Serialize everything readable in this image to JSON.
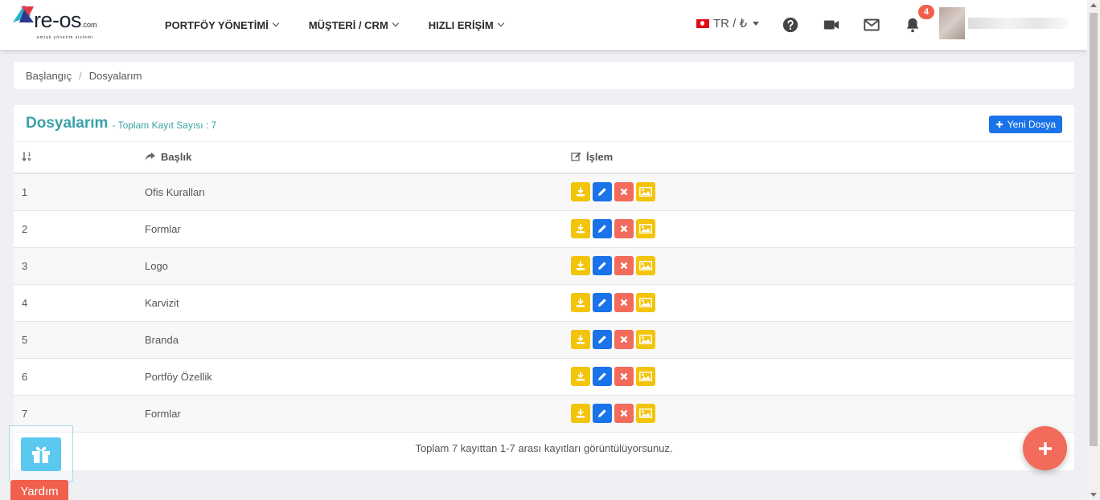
{
  "app": {
    "logo_text": "re-os",
    "logo_domain": ".com",
    "logo_tagline": "emlak yönetim sistemi"
  },
  "nav": {
    "menu": [
      {
        "label": "PORTFÖY YÖNETİMİ"
      },
      {
        "label": "MÜŞTERİ / CRM"
      },
      {
        "label": "HIZLI ERİŞİM"
      }
    ],
    "language": "TR / ₺",
    "notification_count": "4",
    "icons": [
      "help-icon",
      "video-camera-icon",
      "mail-icon",
      "bell-icon"
    ]
  },
  "breadcrumb": {
    "home": "Başlangıç",
    "separator": "/",
    "current": "Dosyalarım"
  },
  "card": {
    "title": "Dosyalarım",
    "subtitle": "- Toplam Kayıt Sayısı : 7",
    "new_button": "Yeni Dosya"
  },
  "table": {
    "columns": {
      "title": "Başlık",
      "action": "İşlem"
    },
    "rows": [
      {
        "no": "1",
        "title": "Ofis Kuralları"
      },
      {
        "no": "2",
        "title": "Formlar"
      },
      {
        "no": "3",
        "title": "Logo"
      },
      {
        "no": "4",
        "title": "Karvizit"
      },
      {
        "no": "5",
        "title": "Branda"
      },
      {
        "no": "6",
        "title": "Portföy Özellik"
      },
      {
        "no": "7",
        "title": "Formlar"
      }
    ],
    "footer": "Toplam 7 kayıttan 1-7 arası kayıtları görüntülüyorsunuz."
  },
  "floating": {
    "help_label": "Yardım"
  },
  "colors": {
    "accent_teal": "#3aa2a8",
    "primary_blue": "#1a73e8",
    "warning_yellow": "#f2c40a",
    "danger_red": "#f26b5b"
  }
}
